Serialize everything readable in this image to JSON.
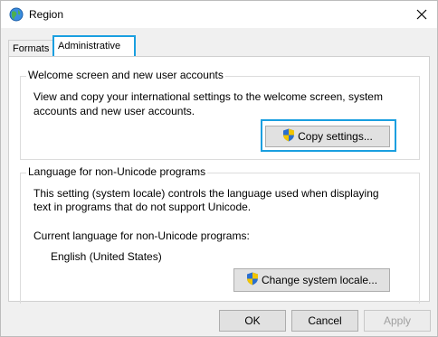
{
  "window": {
    "title": "Region",
    "icon": "globe-icon",
    "close_icon": "close-icon"
  },
  "tabs": [
    {
      "label": "Formats",
      "selected": false
    },
    {
      "label": "Administrative",
      "selected": true
    }
  ],
  "welcome_group": {
    "title": "Welcome screen and new user accounts",
    "description_line1": "View and copy your international settings to the welcome screen, system",
    "description_line2": "accounts and new user accounts.",
    "copy_button": "Copy settings...",
    "shield_icon": "uac-shield-icon"
  },
  "unicode_group": {
    "title": "Language for non-Unicode programs",
    "description_line1": "This setting (system locale) controls the language used when displaying",
    "description_line2": "text in programs that do not support Unicode.",
    "current_label": "Current language for non-Unicode programs:",
    "current_value": "English (United States)",
    "change_button": "Change system locale..."
  },
  "footer": {
    "ok": "OK",
    "cancel": "Cancel",
    "apply": "Apply"
  },
  "colors": {
    "highlight": "#1a9fe0",
    "shield_blue": "#2a6fcf",
    "shield_yellow": "#f2c500"
  }
}
